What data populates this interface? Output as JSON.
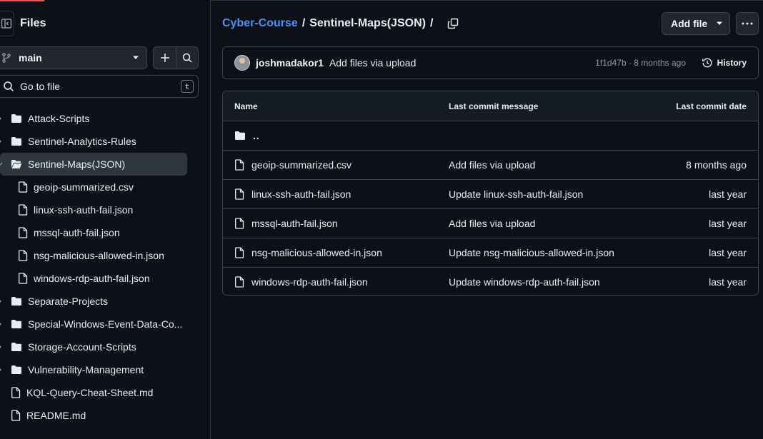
{
  "sidebar": {
    "title": "Files",
    "branch": "main",
    "goto_label": "Go to file",
    "goto_key": "t",
    "tree": [
      {
        "label": "Attack-Scripts",
        "kind": "folder"
      },
      {
        "label": "Sentinel-Analytics-Rules",
        "kind": "folder"
      },
      {
        "label": "Sentinel-Maps(JSON)",
        "kind": "folder-open"
      },
      {
        "label": "geoip-summarized.csv",
        "kind": "file-child"
      },
      {
        "label": "linux-ssh-auth-fail.json",
        "kind": "file-child"
      },
      {
        "label": "mssql-auth-fail.json",
        "kind": "file-child"
      },
      {
        "label": "nsg-malicious-allowed-in.json",
        "kind": "file-child"
      },
      {
        "label": "windows-rdp-auth-fail.json",
        "kind": "file-child"
      },
      {
        "label": "Separate-Projects",
        "kind": "folder"
      },
      {
        "label": "Special-Windows-Event-Data-Co...",
        "kind": "folder"
      },
      {
        "label": "Storage-Account-Scripts",
        "kind": "folder"
      },
      {
        "label": "Vulnerability-Management",
        "kind": "folder"
      },
      {
        "label": "KQL-Query-Cheat-Sheet.md",
        "kind": "file-root"
      },
      {
        "label": "README.md",
        "kind": "file-root"
      }
    ]
  },
  "breadcrumb": {
    "repo": "Cyber-Course",
    "sep": "/",
    "folder": "Sentinel-Maps(JSON)",
    "trail": "/"
  },
  "actions": {
    "add_file": "Add file"
  },
  "commit": {
    "author": "joshmadakor1",
    "message": "Add files via upload",
    "meta": "1f1d47b · 8 months ago",
    "history": "History"
  },
  "table": {
    "headers": [
      "Name",
      "Last commit message",
      "Last commit date"
    ],
    "parent": "..",
    "rows": [
      {
        "name": "geoip-summarized.csv",
        "message": "Add files via upload",
        "date": "8 months ago"
      },
      {
        "name": "linux-ssh-auth-fail.json",
        "message": "Update linux-ssh-auth-fail.json",
        "date": "last year"
      },
      {
        "name": "mssql-auth-fail.json",
        "message": "Add files via upload",
        "date": "last year"
      },
      {
        "name": "nsg-malicious-allowed-in.json",
        "message": "Update nsg-malicious-allowed-in.json",
        "date": "last year"
      },
      {
        "name": "windows-rdp-auth-fail.json",
        "message": "Update windows-rdp-auth-fail.json",
        "date": "last year"
      }
    ]
  },
  "colors": {
    "background": "#0d1117",
    "link": "#4493f8",
    "border": "#3d444d",
    "active_item": "#30363d"
  },
  "icons": {
    "sidebar_toggle": "sidebar-collapse-icon",
    "branch": "git-branch-icon",
    "add": "plus-icon",
    "search": "search-icon",
    "copy": "copy-icon",
    "more": "kebab-horizontal-icon",
    "history": "history-icon",
    "folder": "folder-icon",
    "file": "file-icon"
  }
}
